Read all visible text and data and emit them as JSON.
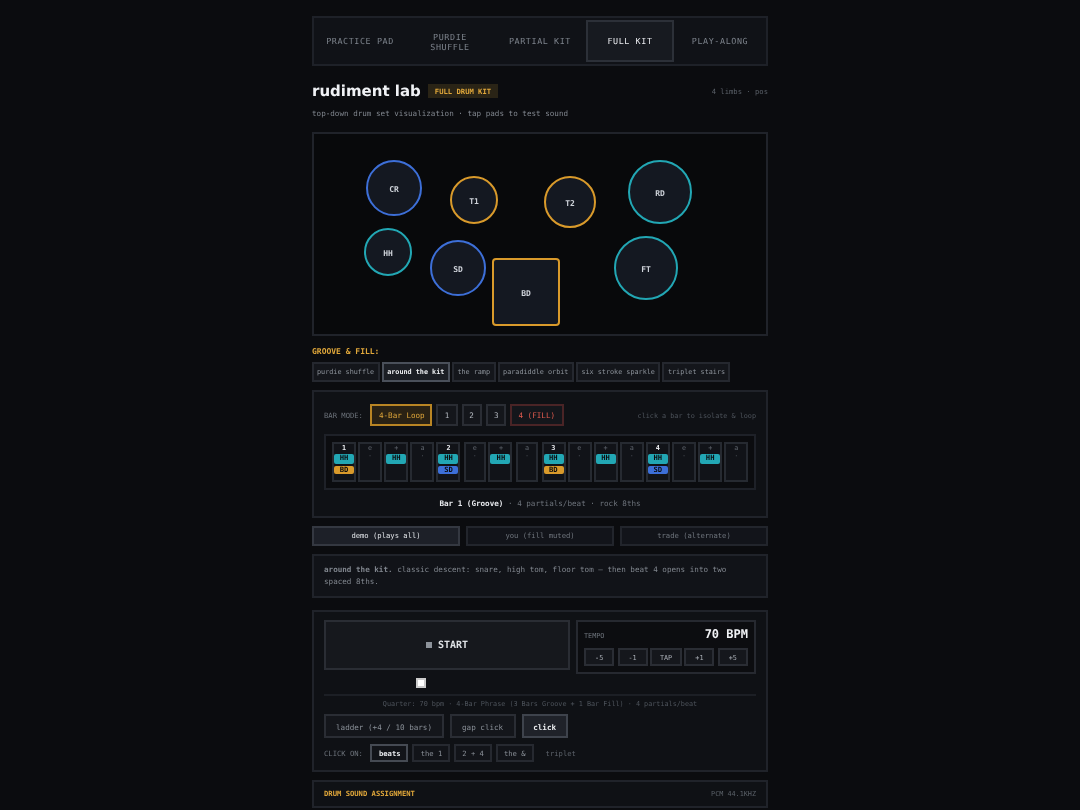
{
  "tabs": [
    {
      "label": "PRACTICE PAD",
      "selected": false
    },
    {
      "label": "PURDIE SHUFFLE",
      "selected": false
    },
    {
      "label": "PARTIAL KIT",
      "selected": false
    },
    {
      "label": "FULL KIT",
      "selected": true
    },
    {
      "label": "PLAY-ALONG",
      "selected": false
    }
  ],
  "header": {
    "title": "rudiment lab",
    "badge": "FULL DRUM KIT",
    "meta": "4 limbs · pos",
    "subtitle": "top-down drum set visualization · tap pads to test sound"
  },
  "pads": [
    {
      "label": "CR",
      "kind": "round",
      "color": "#3d6fd8"
    },
    {
      "label": "T1",
      "kind": "round",
      "color": "#d99a2b"
    },
    {
      "label": "T2",
      "kind": "round",
      "color": "#d99a2b"
    },
    {
      "label": "RD",
      "kind": "round",
      "color": "#22a7b4"
    },
    {
      "label": "HH",
      "kind": "round",
      "color": "#22a7b4"
    },
    {
      "label": "SD",
      "kind": "round",
      "color": "#3d6fd8"
    },
    {
      "label": "BD",
      "kind": "square",
      "color": "#d99a2b"
    },
    {
      "label": "FT",
      "kind": "round",
      "color": "#22a7b4"
    }
  ],
  "groove": {
    "title": "GROOVE & FILL:",
    "items": [
      {
        "label": "purdie shuffle",
        "selected": false
      },
      {
        "label": "around the kit",
        "selected": true
      },
      {
        "label": "the ramp",
        "selected": false
      },
      {
        "label": "paradiddle orbit",
        "selected": false
      },
      {
        "label": "six stroke sparkle",
        "selected": false
      },
      {
        "label": "triplet stairs",
        "selected": false
      }
    ]
  },
  "bar_mode": {
    "label": "BAR MODE:",
    "options": [
      {
        "label": "4-Bar Loop",
        "selected": true,
        "kind": "loop"
      },
      {
        "label": "1",
        "selected": false,
        "kind": "bar"
      },
      {
        "label": "2",
        "selected": false,
        "kind": "bar"
      },
      {
        "label": "3",
        "selected": false,
        "kind": "bar"
      },
      {
        "label": "4 (FILL)",
        "selected": false,
        "kind": "fill"
      }
    ],
    "hint": "click a bar to isolate & loop"
  },
  "steps": [
    {
      "label": "1",
      "hits": [
        {
          "label": "HH",
          "color": "#22a7b4"
        },
        {
          "label": "BD",
          "color": "#d99a2b"
        }
      ]
    },
    {
      "label": "e",
      "rest": "·"
    },
    {
      "label": "+",
      "hits": [
        {
          "label": "HH",
          "color": "#22a7b4"
        }
      ]
    },
    {
      "label": "a",
      "rest": "·"
    },
    {
      "label": "2",
      "hits": [
        {
          "label": "HH",
          "color": "#22a7b4"
        },
        {
          "label": "SD",
          "color": "#3d6fd8"
        }
      ]
    },
    {
      "label": "e",
      "rest": "·"
    },
    {
      "label": "+",
      "hits": [
        {
          "label": "HH",
          "color": "#22a7b4"
        }
      ]
    },
    {
      "label": "a",
      "rest": "·"
    },
    {
      "label": "3",
      "hits": [
        {
          "label": "HH",
          "color": "#22a7b4"
        },
        {
          "label": "BD",
          "color": "#d99a2b"
        }
      ]
    },
    {
      "label": "e",
      "rest": "·"
    },
    {
      "label": "+",
      "hits": [
        {
          "label": "HH",
          "color": "#22a7b4"
        }
      ]
    },
    {
      "label": "a",
      "rest": "·"
    },
    {
      "label": "4",
      "hits": [
        {
          "label": "HH",
          "color": "#22a7b4"
        },
        {
          "label": "SD",
          "color": "#3d6fd8"
        }
      ]
    },
    {
      "label": "e",
      "rest": "·"
    },
    {
      "label": "+",
      "hits": [
        {
          "label": "HH",
          "color": "#22a7b4"
        }
      ]
    },
    {
      "label": "a",
      "rest": "·"
    }
  ],
  "bar_caption": {
    "title": "Bar 1 (Groove)",
    "detail": "· 4 partials/beat · rock 8ths"
  },
  "modes": [
    {
      "label": "demo (plays all)",
      "selected": true
    },
    {
      "label": "you (fill muted)",
      "selected": false
    },
    {
      "label": "trade (alternate)",
      "selected": false
    }
  ],
  "description": "**around the kit.** classic descent: snare, high tom, floor tom — then beat 4 opens into two spaced 8ths.",
  "transport": {
    "start": "START",
    "tempo_label": "TEMPO",
    "tempo": "70 BPM",
    "tempo_buttons": [
      "-5",
      "-1",
      "TAP",
      "+1",
      "+5"
    ],
    "checkbox": {
      "checked": false
    },
    "summary": "Quarter: 70 bpm · 4-Bar Phrase (3 Bars Groove + 1 Bar Fill) · 4 partials/beat"
  },
  "options": [
    {
      "label": "ladder (+4 / 10 bars)",
      "on": false
    },
    {
      "label": "gap click",
      "on": false
    },
    {
      "label": "click",
      "on": true
    }
  ],
  "click_on": {
    "label": "CLICK ON:",
    "items": [
      {
        "label": "beats",
        "selected": true,
        "disabled": false
      },
      {
        "label": "the 1",
        "selected": false,
        "disabled": false
      },
      {
        "label": "2 + 4",
        "selected": false,
        "disabled": false
      },
      {
        "label": "the &",
        "selected": false,
        "disabled": false
      },
      {
        "label": "triplet",
        "selected": false,
        "disabled": true
      }
    ]
  },
  "footer": {
    "title": "DRUM SOUND ASSIGNMENT",
    "meta": "PCM 44.1KHZ"
  }
}
